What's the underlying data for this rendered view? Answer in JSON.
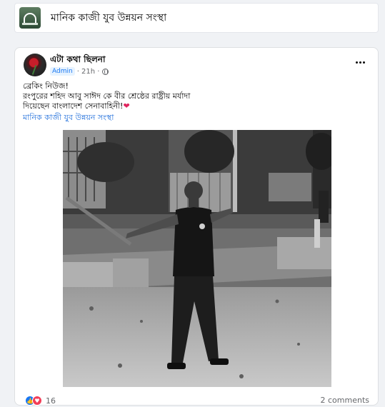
{
  "group": {
    "name": "মানিক কাজী যুব উন্নয়ন সংস্থা",
    "thumbnail_icon": "group-photo-icon"
  },
  "post": {
    "author": "এটা কথা ছিলনা",
    "role_badge": "Admin",
    "time": "· 21h ·",
    "privacy_icon": "globe-icon",
    "more_icon": "more-options-icon",
    "text_lines": [
      "ব্রেকিং নিউজ!",
      "রংপুরের শহিদ আবু সাঈদ কে বীর শ্রেষ্ঠের রাষ্ট্রীয় মর্যাদা",
      "দিয়েছেন বাংলাদেশ সেনাবাহিনী!"
    ],
    "heart_emoji": "❤",
    "group_link": "মানিক কাজী যুব উন্নয়ন সংস্থা",
    "photo_icon": "post-photo",
    "reaction_count": "16",
    "comments": "2 comments"
  },
  "colors": {
    "page_bg": "#f0f2f5",
    "card_bg": "#ffffff",
    "link_blue": "#216fdb",
    "like_blue": "#1877f2",
    "love_red": "#f33e58",
    "muted": "#65676b"
  }
}
